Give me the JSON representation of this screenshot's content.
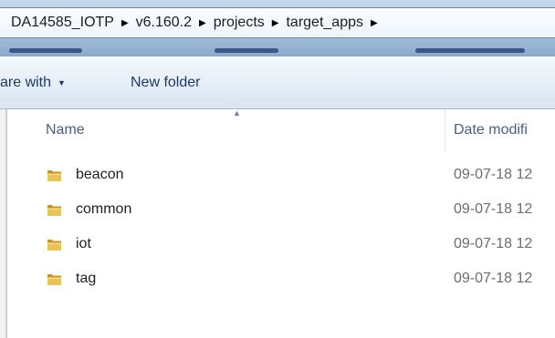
{
  "address_bar": {
    "crumbs": [
      "DA14585_IOTP",
      "v6.160.2",
      "projects",
      "target_apps"
    ],
    "separator": "▶"
  },
  "command_bar": {
    "share_label": "are with",
    "share_caret": "▼",
    "new_folder_label": "New folder"
  },
  "columns": {
    "name": "Name",
    "sort_indicator": "▲",
    "date_modified": "Date modifi"
  },
  "files": [
    {
      "name": "beacon",
      "date": "09-07-18 12",
      "icon": "folder-icon"
    },
    {
      "name": "common",
      "date": "09-07-18 12",
      "icon": "folder-icon"
    },
    {
      "name": "iot",
      "date": "09-07-18 12",
      "icon": "folder-icon"
    },
    {
      "name": "tag",
      "date": "09-07-18 12",
      "icon": "folder-icon"
    }
  ],
  "colors": {
    "folder_body": "#e8c35a",
    "folder_back": "#c9962e",
    "header_text": "#4c607a",
    "command_text": "#1e395b"
  }
}
